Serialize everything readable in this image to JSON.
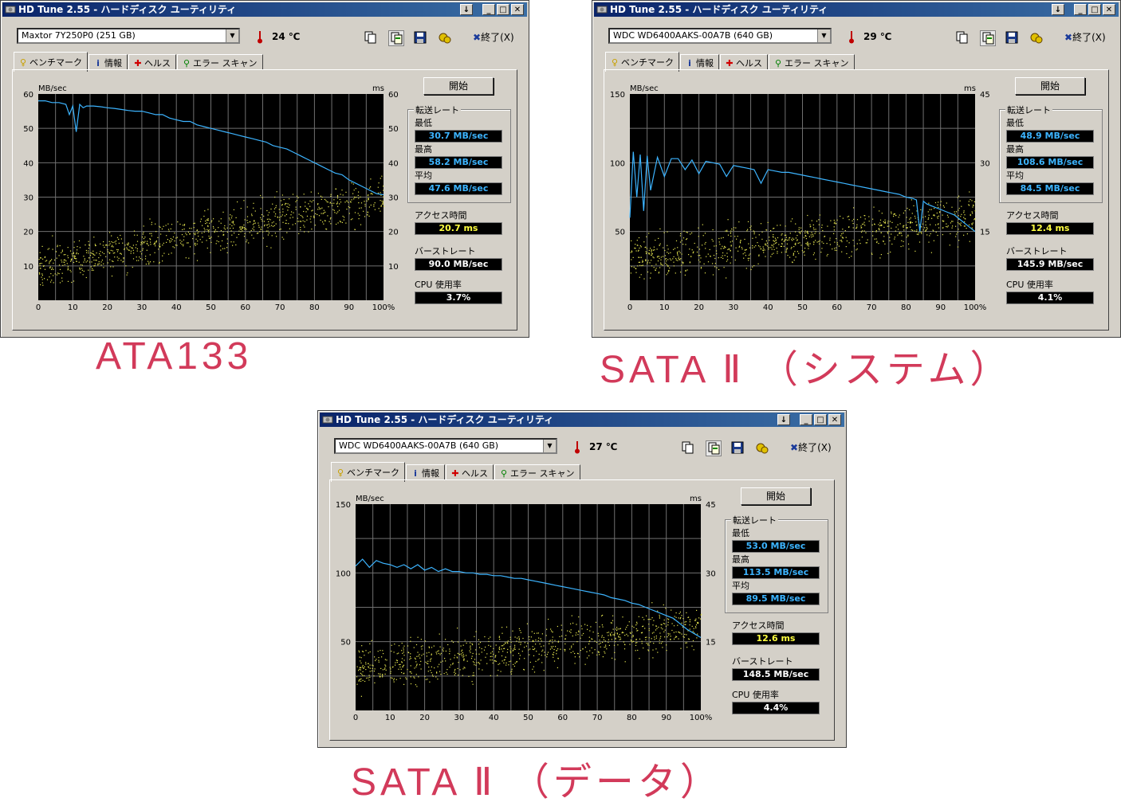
{
  "windows": [
    {
      "title": "HD Tune 2.55 - ハードディスク ユーティリティ",
      "drive": "Maxtor 7Y250P0 (251 GB)",
      "temp": "24 ℃",
      "exit_label": "終了(X)",
      "tabs": [
        "ベンチマーク",
        "情報",
        "ヘルス",
        "エラー スキャン"
      ],
      "start_label": "開始",
      "stats": {
        "transfer_rate_title": "転送レート",
        "min_label": "最低",
        "min": "30.7 MB/sec",
        "max_label": "最高",
        "max": "58.2 MB/sec",
        "avg_label": "平均",
        "avg": "47.6 MB/sec",
        "access_label": "アクセス時間",
        "access": "20.7 ms",
        "burst_label": "バーストレート",
        "burst": "90.0 MB/sec",
        "cpu_label": "CPU 使用率",
        "cpu": "3.7%"
      },
      "chart_data": {
        "type": "line",
        "ylabel_left": "MB/sec",
        "ylabel_right": "ms",
        "yticks_left": [
          "60",
          "50",
          "40",
          "30",
          "20",
          "10"
        ],
        "yticks_right": [
          "60",
          "50",
          "40",
          "30",
          "20",
          "10"
        ],
        "xticks": [
          "0",
          "10",
          "20",
          "30",
          "40",
          "50",
          "60",
          "70",
          "80",
          "90",
          "100%"
        ],
        "ylim_left": [
          0,
          60
        ],
        "ylim_right": [
          0,
          60
        ],
        "transfer_x": [
          0,
          2,
          4,
          6,
          8,
          9,
          10,
          11,
          12,
          13,
          14,
          16,
          18,
          20,
          22,
          24,
          26,
          28,
          30,
          32,
          34,
          36,
          38,
          40,
          42,
          44,
          46,
          48,
          50,
          52,
          54,
          56,
          58,
          60,
          62,
          64,
          66,
          68,
          70,
          72,
          74,
          76,
          78,
          80,
          82,
          84,
          86,
          88,
          90,
          92,
          94,
          96,
          98,
          100
        ],
        "transfer_y": [
          58,
          58,
          57.5,
          57.5,
          57,
          54,
          56.5,
          49,
          57,
          56,
          56.5,
          56.5,
          56.3,
          56,
          55.8,
          55.5,
          55.2,
          55,
          55,
          54.5,
          54,
          54,
          53,
          52.5,
          52,
          52,
          51,
          50.5,
          50,
          49.5,
          49,
          48.5,
          48,
          47.5,
          47,
          46.5,
          46,
          45,
          44.5,
          44,
          43,
          42,
          41,
          40,
          39,
          38,
          37,
          36.5,
          35,
          34,
          33,
          32,
          31,
          30.7
        ],
        "access_trend": [
          10,
          30
        ],
        "access_spread": 5,
        "line_color": "#3cb4ff",
        "dot_color": "#e6e650"
      }
    },
    {
      "title": "HD Tune 2.55 - ハードディスク ユーティリティ",
      "drive": "WDC WD6400AAKS-00A7B (640 GB)",
      "temp": "29 ℃",
      "exit_label": "終了(X)",
      "tabs": [
        "ベンチマーク",
        "情報",
        "ヘルス",
        "エラー スキャン"
      ],
      "start_label": "開始",
      "stats": {
        "transfer_rate_title": "転送レート",
        "min_label": "最低",
        "min": "48.9 MB/sec",
        "max_label": "最高",
        "max": "108.6 MB/sec",
        "avg_label": "平均",
        "avg": "84.5 MB/sec",
        "access_label": "アクセス時間",
        "access": "12.4 ms",
        "burst_label": "バーストレート",
        "burst": "145.9 MB/sec",
        "cpu_label": "CPU 使用率",
        "cpu": "4.1%"
      },
      "chart_data": {
        "type": "line",
        "ylabel_left": "MB/sec",
        "ylabel_right": "ms",
        "yticks_left": [
          "150",
          "100",
          "50"
        ],
        "yticks_right": [
          "45",
          "30",
          "15"
        ],
        "xticks": [
          "0",
          "10",
          "20",
          "30",
          "40",
          "50",
          "60",
          "70",
          "80",
          "90",
          "100%"
        ],
        "ylim_left": [
          0,
          150
        ],
        "ylim_right": [
          0,
          45
        ],
        "transfer_x": [
          0,
          1,
          2,
          3,
          4,
          5,
          6,
          8,
          10,
          12,
          14,
          16,
          18,
          20,
          22,
          24,
          26,
          28,
          30,
          32,
          34,
          36,
          38,
          40,
          42,
          44,
          46,
          48,
          50,
          52,
          54,
          56,
          58,
          60,
          62,
          64,
          66,
          68,
          70,
          72,
          74,
          76,
          78,
          80,
          82,
          83,
          84,
          85,
          86,
          88,
          90,
          92,
          94,
          96,
          98,
          100
        ],
        "transfer_y": [
          60,
          108,
          75,
          106,
          65,
          105,
          80,
          104,
          90,
          103,
          103,
          95,
          102,
          92,
          101,
          100,
          99,
          90,
          98,
          97,
          96,
          95,
          85,
          95,
          94,
          93,
          93,
          92,
          91,
          90,
          89,
          88,
          87,
          86,
          85,
          84,
          83,
          82,
          81,
          80,
          79,
          78,
          77,
          75,
          74,
          73,
          50,
          72,
          70,
          68,
          66,
          64,
          62,
          58,
          54,
          50
        ],
        "access_trend": [
          30,
          60
        ],
        "access_spread": 13,
        "line_color": "#3cb4ff",
        "dot_color": "#e6e650"
      }
    },
    {
      "title": "HD Tune 2.55 - ハードディスク ユーティリティ",
      "drive": "WDC WD6400AAKS-00A7B (640 GB)",
      "temp": "27 ℃",
      "exit_label": "終了(X)",
      "tabs": [
        "ベンチマーク",
        "情報",
        "ヘルス",
        "エラー スキャン"
      ],
      "start_label": "開始",
      "stats": {
        "transfer_rate_title": "転送レート",
        "min_label": "最低",
        "min": "53.0 MB/sec",
        "max_label": "最高",
        "max": "113.5 MB/sec",
        "avg_label": "平均",
        "avg": "89.5 MB/sec",
        "access_label": "アクセス時間",
        "access": "12.6 ms",
        "burst_label": "バーストレート",
        "burst": "148.5 MB/sec",
        "cpu_label": "CPU 使用率",
        "cpu": "4.4%"
      },
      "chart_data": {
        "type": "line",
        "ylabel_left": "MB/sec",
        "ylabel_right": "ms",
        "yticks_left": [
          "150",
          "100",
          "50"
        ],
        "yticks_right": [
          "45",
          "30",
          "15"
        ],
        "xticks": [
          "0",
          "10",
          "20",
          "30",
          "40",
          "50",
          "60",
          "70",
          "80",
          "90",
          "100%"
        ],
        "ylim_left": [
          0,
          150
        ],
        "ylim_right": [
          0,
          45
        ],
        "transfer_x": [
          0,
          2,
          4,
          6,
          8,
          10,
          12,
          14,
          16,
          18,
          20,
          22,
          24,
          26,
          28,
          30,
          32,
          34,
          36,
          38,
          40,
          42,
          44,
          46,
          48,
          50,
          52,
          54,
          56,
          58,
          60,
          62,
          64,
          66,
          68,
          70,
          72,
          74,
          76,
          78,
          80,
          82,
          84,
          86,
          88,
          90,
          92,
          94,
          96,
          98,
          100
        ],
        "transfer_y": [
          105,
          110,
          104,
          109,
          107,
          106,
          104,
          106,
          103,
          106,
          102,
          104,
          101,
          103,
          101,
          101,
          100,
          100,
          99,
          99,
          98,
          98,
          97,
          96,
          96,
          95,
          94,
          93,
          92,
          91,
          90,
          89,
          88,
          87,
          86,
          85,
          84,
          82,
          81,
          80,
          78,
          77,
          75,
          73,
          71,
          69,
          67,
          63,
          59,
          56,
          53
        ],
        "access_trend": [
          30,
          62
        ],
        "access_spread": 13,
        "line_color": "#3cb4ff",
        "dot_color": "#e6e650"
      }
    }
  ],
  "captions": [
    "ATA133",
    "SATA Ⅱ （システム）",
    "SATA Ⅱ （データ）"
  ]
}
